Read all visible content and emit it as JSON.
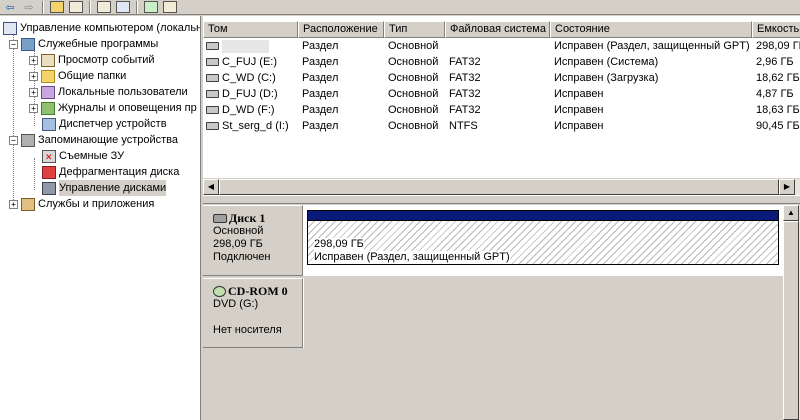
{
  "toolbar": {
    "buttons": [
      "back-icon",
      "forward-icon",
      "up-folder-icon",
      "show-hide-tree-icon",
      "properties-icon",
      "help-icon",
      "refresh-icon",
      "export-icon"
    ]
  },
  "tree": {
    "root": "Управление компьютером (локальны",
    "system_tools": "Служебные программы",
    "event_viewer": "Просмотр событий",
    "shared_folders": "Общие папки",
    "local_users": "Локальные пользователи",
    "logs_alerts": "Журналы и оповещения пр",
    "device_manager": "Диспетчер устройств",
    "storage": "Запоминающие устройства",
    "removable": "Съемные ЗУ",
    "defrag": "Дефрагментация диска",
    "disk_management": "Управление дисками",
    "services": "Службы и приложения"
  },
  "volumes": {
    "columns": [
      "Том",
      "Расположение",
      "Тип",
      "Файловая система",
      "Состояние",
      "Емкость"
    ],
    "rows": [
      {
        "name": "",
        "location": "Раздел",
        "type": "Основной",
        "fs": "",
        "status": "Исправен (Раздел, защищенный GPT)",
        "capacity": "298,09 ГБ"
      },
      {
        "name": "C_FUJ (E:)",
        "location": "Раздел",
        "type": "Основной",
        "fs": "FAT32",
        "status": "Исправен (Система)",
        "capacity": "2,96 ГБ"
      },
      {
        "name": "C_WD (C:)",
        "location": "Раздел",
        "type": "Основной",
        "fs": "FAT32",
        "status": "Исправен (Загрузка)",
        "capacity": "18,62 ГБ"
      },
      {
        "name": "D_FUJ (D:)",
        "location": "Раздел",
        "type": "Основной",
        "fs": "FAT32",
        "status": "Исправен",
        "capacity": "4,87 ГБ"
      },
      {
        "name": "D_WD (F:)",
        "location": "Раздел",
        "type": "Основной",
        "fs": "FAT32",
        "status": "Исправен",
        "capacity": "18,63 ГБ"
      },
      {
        "name": "St_serg_d (I:)",
        "location": "Раздел",
        "type": "Основной",
        "fs": "NTFS",
        "status": "Исправен",
        "capacity": "90,45 ГБ"
      }
    ]
  },
  "disks": {
    "disk1": {
      "title": "Диск 1",
      "type": "Основной",
      "size": "298,09 ГБ",
      "state": "Подключен",
      "partition_size": "298,09 ГБ",
      "partition_status": "Исправен (Раздел, защищенный GPT)"
    },
    "cdrom0": {
      "title": "CD-ROM 0",
      "drive": "DVD (G:)",
      "state": "Нет носителя"
    }
  }
}
